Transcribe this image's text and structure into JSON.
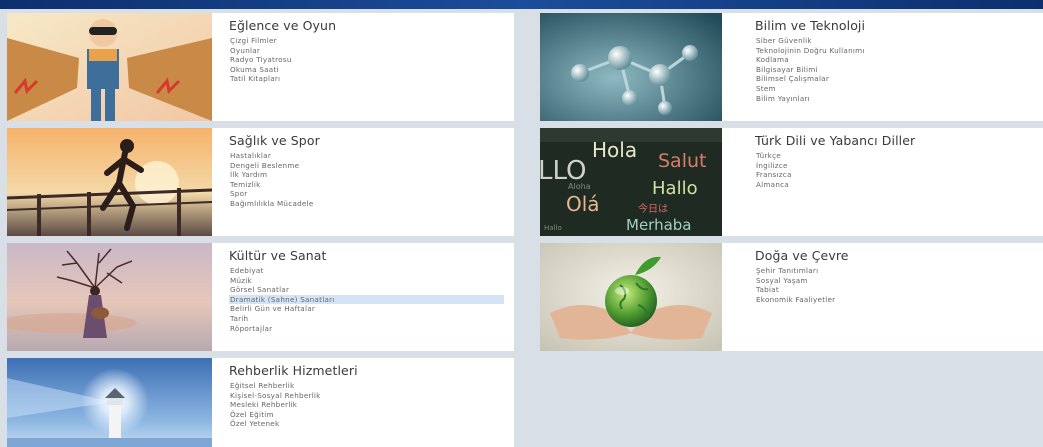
{
  "categories": [
    {
      "title": "Eğlence ve Oyun",
      "image": "child-with-cardboard-wings-image",
      "links": [
        "Çizgi Filmler",
        "Oyunlar",
        "Radyo Tiyatrosu",
        "Okuma Saati",
        "Tatil Kitapları"
      ]
    },
    {
      "title": "Bilim ve Teknoloji",
      "image": "molecule-model-image",
      "links": [
        "Siber Güvenlik",
        "Teknolojinin Doğru Kullanımı",
        "Kodlama",
        "Bilgisayar Bilimi",
        "Bilimsel Çalışmalar",
        "Stem",
        "Bilim Yayınları"
      ]
    },
    {
      "title": "Sağlık ve Spor",
      "image": "runner-at-sunset-image",
      "links": [
        "Hastalıklar",
        "Dengeli Beslenme",
        "İlk Yardım",
        "Temizlik",
        "Spor",
        "Bağımlılıkla Mücadele"
      ]
    },
    {
      "title": "Türk Dili ve Yabancı Diller",
      "image": "greeting-words-image",
      "image_words": [
        "Hola",
        "Salut",
        "LLO",
        "Hallo",
        "Olá",
        "今日は",
        "Merhaba",
        "Aloha",
        "Hallo"
      ],
      "links": [
        "Türkçe",
        "İngilizce",
        "Fransızca",
        "Almanca"
      ]
    },
    {
      "title": "Kültür ve Sanat",
      "image": "tree-woman-art-image",
      "links": [
        "Edebiyat",
        "Müzik",
        "Görsel Sanatlar",
        "Dramatik (Sahne) Sanatları",
        "Belirli Gün ve Haftalar",
        "Tarih",
        "Röportajlar"
      ]
    },
    {
      "title": "Doğa ve Çevre",
      "image": "globe-in-hands-image",
      "links": [
        "Şehir Tanıtımları",
        "Sosyal Yaşam",
        "Tabiat",
        "Ekonomik Faaliyetler"
      ]
    },
    {
      "title": "Rehberlik Hizmetleri",
      "image": "lighthouse-image",
      "links": [
        "Eğitsel Rehberlik",
        "Kişisel-Sosyal Rehberlik",
        "Mesleki Rehberlik",
        "Özel Eğitim",
        "Özel Yetenek"
      ]
    }
  ],
  "highlighted_link": "Dramatik (Sahne) Sanatları",
  "colors": {
    "background": "#d9dfe6",
    "card": "#ffffff",
    "topbar": "#1b4d9a",
    "highlight": "#d4e4f6"
  }
}
